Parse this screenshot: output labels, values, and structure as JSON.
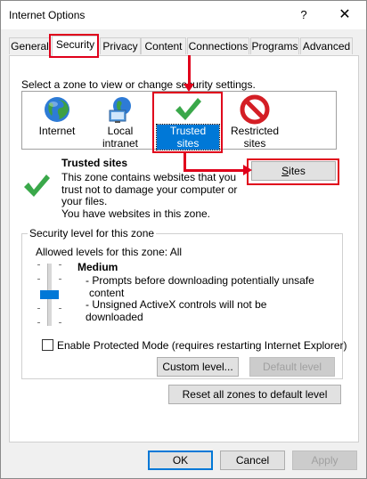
{
  "window": {
    "title": "Internet Options",
    "help_glyph": "?",
    "close_glyph": "✕"
  },
  "tabs": [
    {
      "label": "General"
    },
    {
      "label": "Security"
    },
    {
      "label": "Privacy"
    },
    {
      "label": "Content"
    },
    {
      "label": "Connections"
    },
    {
      "label": "Programs"
    },
    {
      "label": "Advanced"
    }
  ],
  "zones": {
    "prompt": "Select a zone to view or change security settings.",
    "items": [
      {
        "label": "Internet",
        "icon": "globe-icon"
      },
      {
        "label": "Local intranet",
        "icon": "intranet-icon"
      },
      {
        "label": "Trusted sites",
        "icon": "checkmark-icon",
        "selected": true
      },
      {
        "label_line1": "Restricted",
        "label_line2": "sites",
        "icon": "no-entry-icon"
      }
    ]
  },
  "detail": {
    "title": "Trusted sites",
    "description": "This zone contains websites that you trust not to damage your computer or your files.",
    "extra": "You have websites in this zone.",
    "sites_button": "Sites",
    "sites_mnemonic": "S"
  },
  "security_level": {
    "group_label": "Security level for this zone",
    "allowed_label": "Allowed levels for this zone: All",
    "level_name": "Medium",
    "bullet1_line1": "- Prompts before downloading potentially unsafe",
    "bullet1_line2": "content",
    "bullet2": "- Unsigned ActiveX controls will not be downloaded",
    "protected_mode_label": "Enable Protected Mode (requires restarting Internet Explorer)",
    "protected_mode_checked": false,
    "custom_level_button": "Custom level...",
    "default_level_button": "Default level",
    "reset_button": "Reset all zones to default level"
  },
  "footer": {
    "ok": "OK",
    "cancel": "Cancel",
    "apply": "Apply"
  },
  "colors": {
    "annotation_red": "#e0001b",
    "selection_blue": "#0078d7",
    "check_green": "#3aa84a"
  }
}
